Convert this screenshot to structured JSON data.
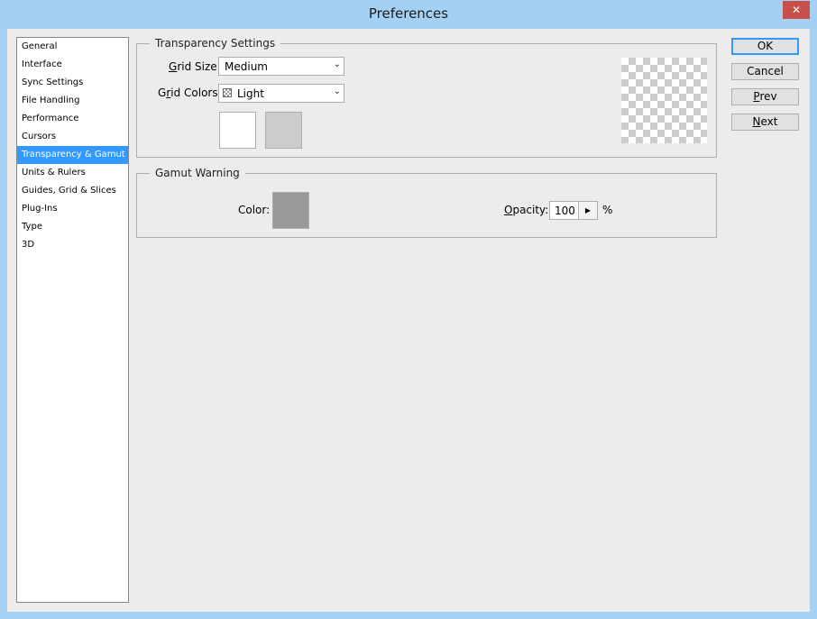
{
  "window": {
    "title": "Preferences",
    "close_glyph": "✕"
  },
  "sidebar": {
    "items": [
      {
        "label": "General",
        "selected": false
      },
      {
        "label": "Interface",
        "selected": false
      },
      {
        "label": "Sync Settings",
        "selected": false
      },
      {
        "label": "File Handling",
        "selected": false
      },
      {
        "label": "Performance",
        "selected": false
      },
      {
        "label": "Cursors",
        "selected": false
      },
      {
        "label": "Transparency & Gamut",
        "selected": true
      },
      {
        "label": "Units & Rulers",
        "selected": false
      },
      {
        "label": "Guides, Grid & Slices",
        "selected": false
      },
      {
        "label": "Plug-Ins",
        "selected": false
      },
      {
        "label": "Type",
        "selected": false
      },
      {
        "label": "3D",
        "selected": false
      }
    ]
  },
  "transparency": {
    "legend": "Transparency Settings",
    "grid_size_label_u": "G",
    "grid_size_label_rest": "rid Size:",
    "grid_size_value": "Medium",
    "grid_colors_label_pre": "G",
    "grid_colors_label_u": "r",
    "grid_colors_label_rest": "id Colors:",
    "grid_colors_value": "Light",
    "swatch1_color": "#ffffff",
    "swatch2_color": "#cccccc"
  },
  "gamut": {
    "legend": "Gamut Warning",
    "color_label": "Color:",
    "color_value": "#999999",
    "opacity_label_u": "O",
    "opacity_label_rest": "pacity:",
    "opacity_value": "100",
    "opacity_unit": "%"
  },
  "buttons": {
    "ok": "OK",
    "cancel": "Cancel",
    "prev_u": "P",
    "prev_rest": "rev",
    "next_u": "N",
    "next_rest": "ext"
  },
  "icons": {
    "dropdown": "chevron-down-icon",
    "spin": "triangle-right-icon",
    "close": "close-icon"
  }
}
